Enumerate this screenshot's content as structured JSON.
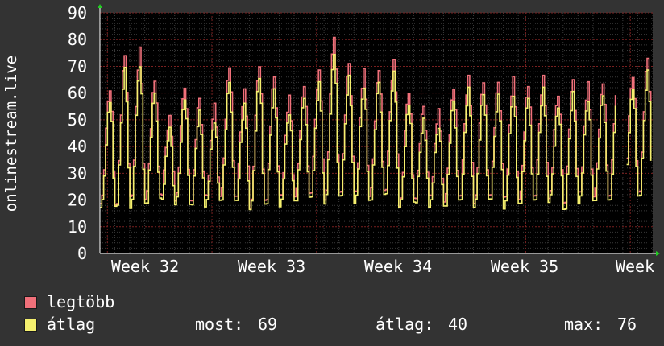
{
  "chart_data": {
    "type": "line",
    "ylabel": "onlinestream.live",
    "ylim": [
      0,
      90
    ],
    "yticks": [
      0,
      10,
      20,
      30,
      40,
      50,
      60,
      70,
      80,
      90
    ],
    "xticks": [
      "Week 32",
      "Week 33",
      "Week 34",
      "Week 35",
      "Week"
    ],
    "grid": true,
    "samples_per_day": 8,
    "gaps": [
      [
        34.6,
        35.2
      ]
    ],
    "series": [
      {
        "name": "legtöbb",
        "color": "#f0707a",
        "daily_min": [
          19,
          17,
          19,
          20,
          21,
          20,
          19,
          20,
          21,
          20,
          17,
          19,
          20,
          21,
          21,
          20,
          22,
          21,
          21,
          22,
          18,
          20,
          20,
          19,
          20,
          19,
          21,
          19,
          20,
          20,
          21,
          18,
          21,
          21,
          20,
          23,
          22
        ],
        "daily_max": [
          62,
          74,
          76,
          65,
          51,
          63,
          58,
          55,
          70,
          61,
          71,
          66,
          58,
          63,
          68,
          82,
          71,
          68,
          69,
          72,
          61,
          55,
          53,
          62,
          66,
          65,
          64,
          65,
          63,
          66,
          60,
          65,
          63,
          64,
          66,
          67,
          73
        ]
      },
      {
        "name": "átlag",
        "color": "#f5f06e",
        "daily_min": [
          17,
          16,
          17,
          18,
          19,
          18,
          17,
          18,
          19,
          18,
          16,
          17,
          18,
          19,
          19,
          18,
          20,
          19,
          19,
          20,
          17,
          18,
          18,
          17,
          18,
          17,
          19,
          17,
          18,
          18,
          19,
          15,
          19,
          19,
          18,
          21,
          20
        ],
        "daily_max": [
          57,
          69,
          71,
          60,
          46,
          58,
          53,
          50,
          64,
          55,
          66,
          61,
          53,
          58,
          63,
          75,
          66,
          63,
          64,
          67,
          56,
          50,
          48,
          57,
          61,
          60,
          59,
          60,
          58,
          61,
          55,
          60,
          58,
          59,
          61,
          62,
          68
        ]
      }
    ]
  },
  "legend": [
    {
      "label": "legtöbb",
      "color": "#f0707a"
    },
    {
      "label": "átlag",
      "color": "#f5f06e"
    }
  ],
  "stats": {
    "current_label": "most:",
    "current_value": "69",
    "average_label": "átlag:",
    "average_value": "40",
    "max_label": "max:",
    "max_value": "76"
  }
}
